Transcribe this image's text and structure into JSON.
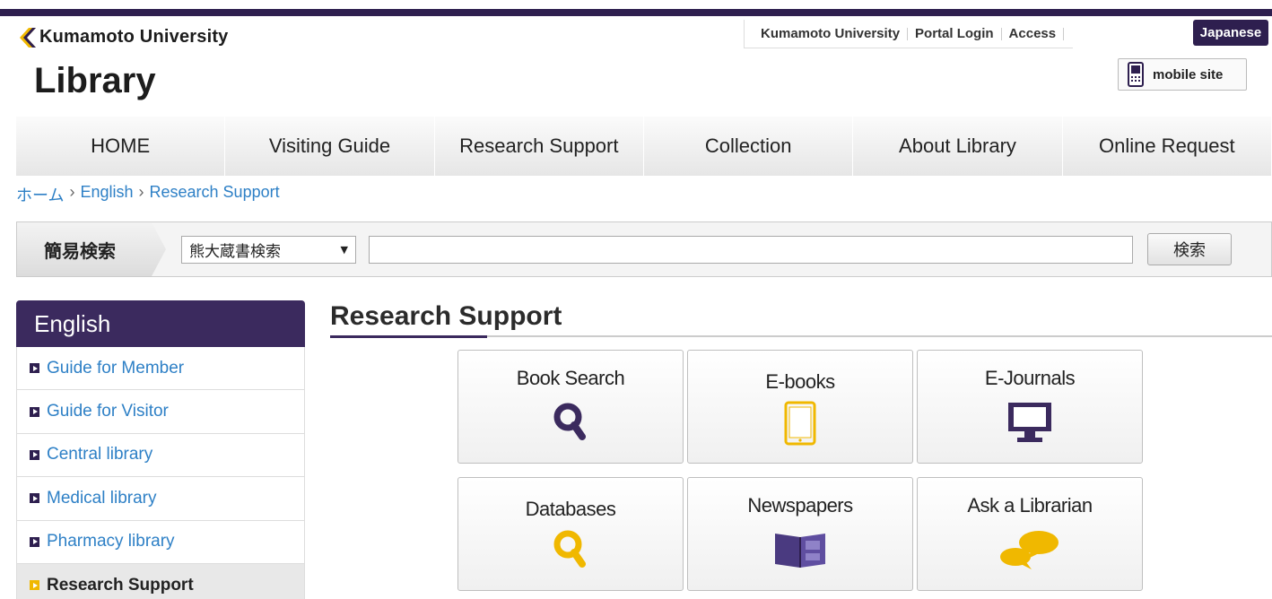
{
  "header": {
    "university": "Kumamoto University",
    "library": "Library",
    "util_links": [
      "Kumamoto University",
      "Portal Login",
      "Access"
    ],
    "lang_button": "Japanese",
    "mobile_label": "mobile site",
    "accent_color": "#2e1f4f"
  },
  "nav": {
    "items": [
      "HOME",
      "Visiting Guide",
      "Research Support",
      "Collection",
      "About Library",
      "Online Request"
    ]
  },
  "breadcrumb": [
    "ホーム",
    "English",
    "Research Support"
  ],
  "search": {
    "tab_label": "簡易検索",
    "selected": "熊大蔵書検索",
    "input_value": "",
    "button": "検索"
  },
  "sidebar": {
    "heading": "English",
    "items": [
      {
        "label": "Guide for Member"
      },
      {
        "label": "Guide for Visitor"
      },
      {
        "label": "Central library"
      },
      {
        "label": "Medical library"
      },
      {
        "label": "Pharmacy library"
      },
      {
        "label": "Research Support",
        "active": true
      }
    ]
  },
  "main": {
    "title": "Research Support",
    "tiles": [
      {
        "label": "Book Search",
        "icon": "magnifier-icon",
        "color": "#3b2a5e"
      },
      {
        "label": "E-books",
        "icon": "tablet-icon",
        "color": "#f0b800"
      },
      {
        "label": "E-Journals",
        "icon": "monitor-icon",
        "color": "#3b2a5e"
      },
      {
        "label": "Databases",
        "icon": "magnifier-icon",
        "color": "#f0b800"
      },
      {
        "label": "Newspapers",
        "icon": "newspaper-icon",
        "color": "#4a3a80"
      },
      {
        "label": "Ask a Librarian",
        "icon": "speech-bubbles-icon",
        "color": "#f0b800"
      }
    ]
  }
}
